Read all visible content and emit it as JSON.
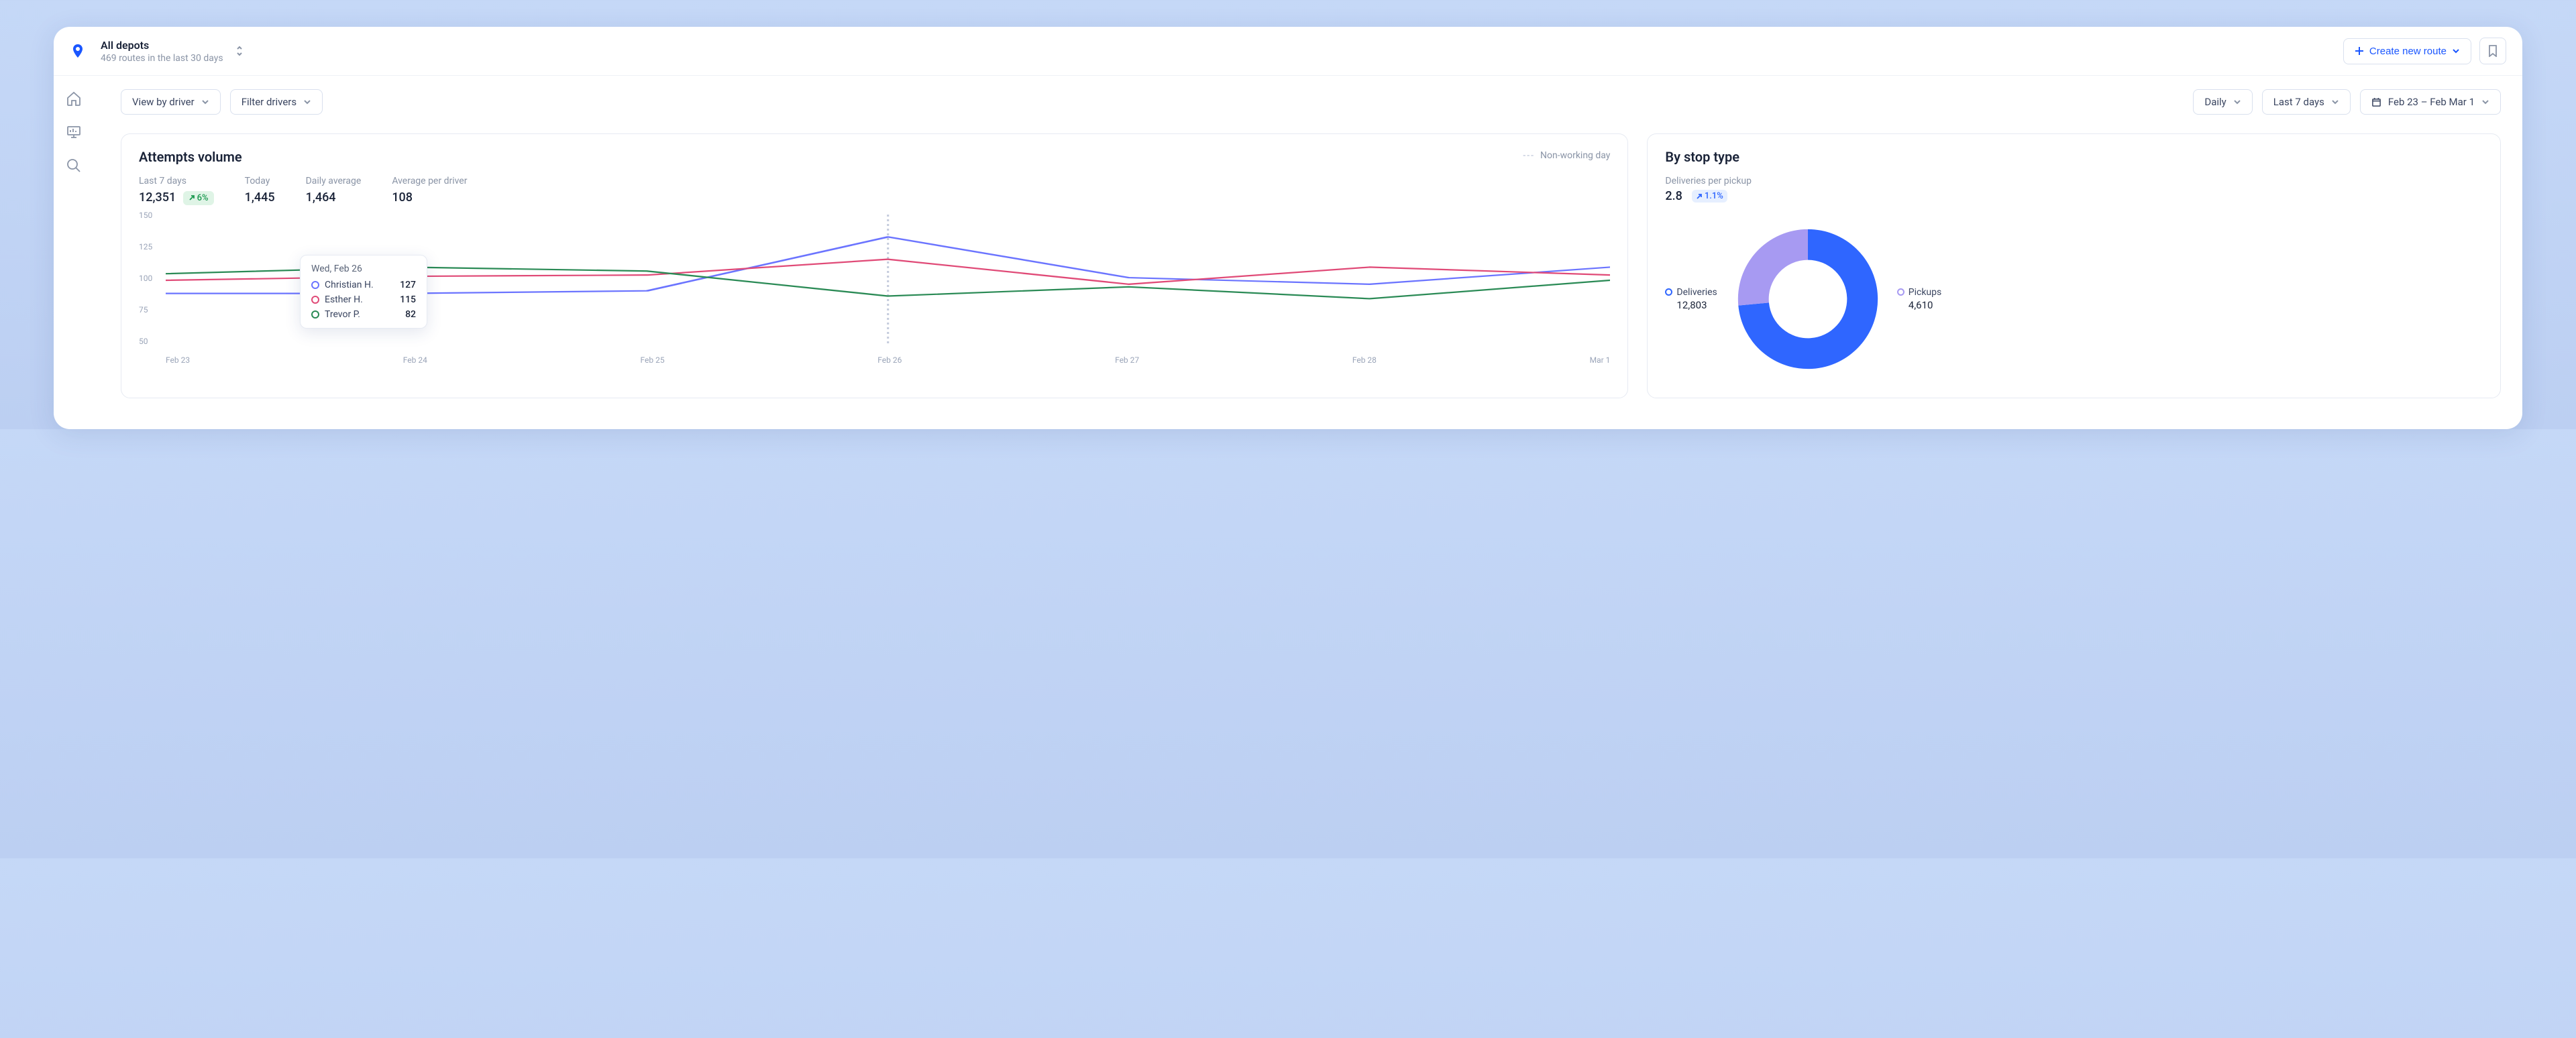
{
  "header": {
    "depot_title": "All depots",
    "depot_sub": "469 routes in the last 30 days",
    "create_label": "Create new route"
  },
  "filters": {
    "view_by": "View by driver",
    "filter_drivers": "Filter drivers",
    "granularity": "Daily",
    "range": "Last 7 days",
    "date_range": "Feb 23 – Feb Mar 1"
  },
  "attempts": {
    "title": "Attempts volume",
    "legend_nonworking": "Non-working day",
    "stats": {
      "last7_label": "Last 7 days",
      "last7_value": "12,351",
      "last7_delta": "6%",
      "today_label": "Today",
      "today_value": "1,445",
      "avg_label": "Daily average",
      "avg_value": "1,464",
      "perdriver_label": "Average per driver",
      "perdriver_value": "108"
    },
    "tooltip": {
      "title": "Wed, Feb 26",
      "rows": [
        {
          "color": "#6b74ff",
          "name": "Christian H.",
          "value": "127"
        },
        {
          "color": "#e04a77",
          "name": "Esther H.",
          "value": "115"
        },
        {
          "color": "#2a8a55",
          "name": "Trevor P.",
          "value": "82"
        }
      ]
    }
  },
  "stoptype": {
    "title": "By stop type",
    "subtitle": "Deliveries per pickup",
    "ratio": "2.8",
    "delta": "1.1%",
    "deliveries_label": "Deliveries",
    "deliveries_value": "12,803",
    "pickups_label": "Pickups",
    "pickups_value": "4,610"
  },
  "chart_data": [
    {
      "type": "line",
      "title": "Attempts volume",
      "ylabel": "",
      "ylim": [
        50,
        150
      ],
      "yticks": [
        50,
        75,
        100,
        125,
        150
      ],
      "categories": [
        "Feb 23",
        "Feb 24",
        "Feb 25",
        "Feb 26",
        "Feb 27",
        "Feb 28",
        "Mar 1"
      ],
      "non_working_index": 3,
      "series": [
        {
          "name": "Christian H.",
          "color": "#6b74ff",
          "values": [
            90,
            90,
            92,
            133,
            102,
            97,
            110
          ]
        },
        {
          "name": "Esther H.",
          "color": "#e04a77",
          "values": [
            100,
            103,
            104,
            116,
            97,
            110,
            104
          ]
        },
        {
          "name": "Trevor P.",
          "color": "#2a8a55",
          "values": [
            105,
            110,
            107,
            88,
            95,
            86,
            100
          ]
        }
      ]
    },
    {
      "type": "pie",
      "title": "By stop type",
      "series": [
        {
          "name": "Deliveries",
          "value": 12803,
          "color": "#2f66ff"
        },
        {
          "name": "Pickups",
          "value": 4610,
          "color": "#a79af2"
        }
      ]
    }
  ]
}
